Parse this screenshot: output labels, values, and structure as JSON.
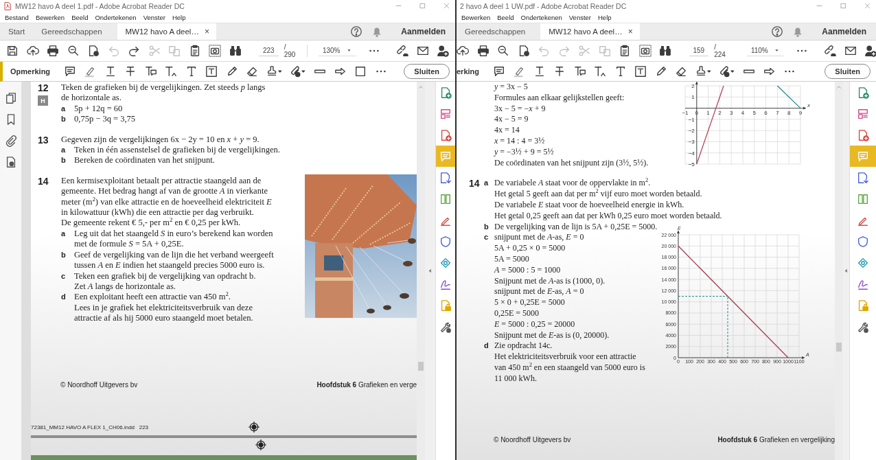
{
  "windows": [
    {
      "app_icon": true,
      "title": "MW12 havo A deel 1.pdf - Adobe Acrobat Reader DC",
      "menu": [
        "Bestand",
        "Bewerken",
        "Beeld",
        "Ondertekenen",
        "Venster",
        "Help"
      ],
      "tabs": [
        {
          "label": "Start",
          "selected": false
        },
        {
          "label": "Gereedschappen",
          "selected": false
        },
        {
          "label": "MW12 havo A deel…",
          "selected": true,
          "close": "×"
        }
      ],
      "sign_in": "Aanmelden",
      "toolbar": {
        "tools": [
          {
            "kind": "save",
            "disabled": false
          },
          {
            "kind": "upload",
            "disabled": false
          },
          {
            "kind": "print",
            "disabled": false
          },
          {
            "kind": "magnifier",
            "disabled": false
          },
          {
            "kind": "review",
            "disabled": false
          },
          {
            "kind": "undo",
            "disabled": true
          },
          {
            "kind": "redo",
            "disabled": false
          },
          {
            "kind": "cut",
            "disabled": true
          },
          {
            "kind": "copy",
            "disabled": true
          },
          {
            "kind": "clipboard",
            "disabled": false
          },
          {
            "kind": "snapshot",
            "disabled": false
          },
          {
            "kind": "find",
            "disabled": false
          }
        ],
        "page": {
          "current": "223",
          "total": "/ 290"
        },
        "zoom": "130%",
        "end_tools": [
          {
            "kind": "link"
          },
          {
            "kind": "mail"
          },
          {
            "kind": "adduser"
          }
        ]
      },
      "comment_bar": {
        "label": "Opmerking",
        "tools": [
          {
            "kind": "note"
          },
          {
            "kind": "highlight"
          },
          {
            "kind": "underline"
          },
          {
            "kind": "strike"
          },
          {
            "kind": "textnote"
          },
          {
            "kind": "insert"
          },
          {
            "kind": "text"
          },
          {
            "kind": "textbox"
          },
          {
            "kind": "pencil"
          },
          {
            "kind": "eraser"
          },
          {
            "kind": "stamp"
          },
          {
            "kind": "attach"
          },
          {
            "kind": "line"
          },
          {
            "kind": "arrow"
          },
          {
            "kind": "rect"
          }
        ],
        "close": "Sluiten"
      },
      "side_rail": [
        {
          "kind": "pages"
        },
        {
          "kind": "bookmark"
        },
        {
          "kind": "paperclip"
        },
        {
          "kind": "tagdoc"
        }
      ],
      "tool_panel": [
        {
          "kind": "create",
          "selected": false
        },
        {
          "kind": "layout",
          "selected": false
        },
        {
          "kind": "combine",
          "selected": false
        },
        {
          "kind": "comment",
          "selected": true
        },
        {
          "kind": "export",
          "selected": false
        },
        {
          "kind": "organize",
          "selected": false
        },
        {
          "kind": "edit",
          "selected": false
        },
        {
          "kind": "protect",
          "selected": false
        },
        {
          "kind": "certify",
          "selected": false
        },
        {
          "kind": "sign",
          "selected": false
        },
        {
          "kind": "lockdoc",
          "selected": false
        },
        {
          "kind": "tools",
          "selected": false
        }
      ],
      "page": {
        "blocks": [
          {
            "number": "12",
            "badge": "H",
            "lines": [
              "Teken de grafieken bij de vergelijkingen. Zet steeds *p* langs",
              "de horizontale as."
            ],
            "parts": [
              {
                "label": "a",
                "lines": [
                  "5p + 12q = 60"
                ]
              },
              {
                "label": "b",
                "lines": [
                  "0,75p − 3q = 3,75"
                ]
              }
            ]
          },
          {
            "number": "13",
            "lines": [
              "Gegeven zijn de vergelijkingen 6x − 2y = 10 en *x* + *y* = 9."
            ],
            "parts": [
              {
                "label": "a",
                "lines": [
                  "Teken in één assenstelsel de grafieken bij de vergelijkingen."
                ]
              },
              {
                "label": "b",
                "lines": [
                  "Bereken de coördinaten van het snijpunt."
                ]
              }
            ]
          },
          {
            "number": "14",
            "picture": {
              "kind": "picture"
            },
            "lines": [
              "Een kermisexploitant betaalt per attractie staangeld aan de",
              "gemeente. Het bedrag hangt af van de grootte *A* in vierkante",
              "meter (m$^{2}$) van elke attractie en de hoeveelheid elektriciteit *E*",
              "in kilowattuur (kWh) die een attractie per dag verbruikt.",
              "De gemeente rekent € 5,- per m$^{2}$ en € 0,25 per kWh."
            ],
            "parts": [
              {
                "label": "a",
                "lines": [
                  "Leg uit dat het staangeld *S* in euro’s berekend kan worden",
                  "met de formule *S* = 5A + 0,25E."
                ]
              },
              {
                "label": "b",
                "lines": [
                  "Geef de vergelijking van de lijn die het verband weergeeft",
                  "tussen *A* en *E* indien het staangeld precies 5000 euro is."
                ]
              },
              {
                "label": "c",
                "lines": [
                  "Teken een grafiek bij de vergelijking van opdracht b.",
                  "Zet *A* langs de horizontale as."
                ]
              },
              {
                "label": "d",
                "lines": [
                  "Een exploitant heeft een attractie van 450 m$^{2}$.",
                  "Lees in je grafiek het elektriciteitsverbruik van deze",
                  "attractie af als hij 5000 euro staangeld moet betalen."
                ]
              }
            ]
          }
        ],
        "footer": {
          "left": "© Noordhoff Uitgevers bv",
          "right": "**Hoofdstuk 6** Grafieken en verge"
        },
        "slug": "72381_MM12 HAVO A FLEX 1_CH06.indd   223"
      }
    },
    {
      "title": "2 havo A deel 1 UW.pdf - Adobe Acrobat Reader DC",
      "menu": [
        "Bewerken",
        "Beeld",
        "Ondertekenen",
        "Venster",
        "Help"
      ],
      "tabs": [
        {
          "label": "Gereedschappen",
          "selected": false
        },
        {
          "label": "MW12 havo A deel…",
          "selected": true,
          "close": "×"
        }
      ],
      "sign_in": "Aanmelden",
      "toolbar": {
        "tools": [
          {
            "kind": "upload",
            "disabled": false
          },
          {
            "kind": "print",
            "disabled": false
          },
          {
            "kind": "magnifier",
            "disabled": false
          },
          {
            "kind": "review",
            "disabled": false
          },
          {
            "kind": "undo",
            "disabled": true
          },
          {
            "kind": "redo",
            "disabled": true
          },
          {
            "kind": "cut",
            "disabled": true
          },
          {
            "kind": "copy",
            "disabled": true
          },
          {
            "kind": "clipboard",
            "disabled": false
          },
          {
            "kind": "snapshot",
            "disabled": false
          },
          {
            "kind": "find",
            "disabled": false
          }
        ],
        "page": {
          "current": "159",
          "total": "/ 224"
        },
        "zoom": "110%",
        "end_tools": [
          {
            "kind": "link"
          },
          {
            "kind": "mail"
          },
          {
            "kind": "adduser"
          }
        ]
      },
      "comment_bar": {
        "label": "erking",
        "tools": [
          {
            "kind": "note"
          },
          {
            "kind": "highlight"
          },
          {
            "kind": "underline"
          },
          {
            "kind": "strike"
          },
          {
            "kind": "textnote"
          },
          {
            "kind": "insert"
          },
          {
            "kind": "text"
          },
          {
            "kind": "textbox"
          },
          {
            "kind": "pencil"
          },
          {
            "kind": "eraser"
          },
          {
            "kind": "stamp"
          },
          {
            "kind": "attach"
          },
          {
            "kind": "line"
          },
          {
            "kind": "arrow"
          }
        ],
        "close": "Sluiten"
      },
      "tool_panel": [
        {
          "kind": "create",
          "selected": false
        },
        {
          "kind": "layout",
          "selected": false
        },
        {
          "kind": "combine",
          "selected": false
        },
        {
          "kind": "comment",
          "selected": true
        },
        {
          "kind": "export",
          "selected": false
        },
        {
          "kind": "organize",
          "selected": false
        },
        {
          "kind": "edit",
          "selected": false
        },
        {
          "kind": "protect",
          "selected": false
        },
        {
          "kind": "certify",
          "selected": false
        },
        {
          "kind": "sign",
          "selected": false
        },
        {
          "kind": "lockdoc",
          "selected": false
        },
        {
          "kind": "tools",
          "selected": false
        }
      ],
      "page": {
        "blocks": [
          {
            "parts": [
              {
                "lines": [
                  "*y* = 3x − 5",
                  "Formules aan elkaar gelijkstellen geeft:",
                  "3x − 5 = −*x* + 9",
                  "4x − 5 = 9",
                  "4x = 14",
                  "*x* = 14 : 4 = 3½",
                  "*y* = −3½ + 9 = 5½",
                  "De coördinaten van het snijpunt zijn (3½, 5½)."
                ]
              }
            ],
            "chart_data": {
              "type": "line",
              "grid": true,
              "xlabel": "x",
              "x": [
                0,
                2.333,
                7,
                9
              ],
              "series": [
                {
                  "color": "#b5475c",
                  "values": [
                    -5,
                    2,
                    null,
                    null
                  ]
                },
                {
                  "color": "#1f8f86",
                  "values": [
                    null,
                    null,
                    2,
                    0
                  ]
                }
              ],
              "xlim": [
                -1,
                9
              ],
              "ylim": [
                -5,
                2
              ],
              "xticks": [
                {
                  "value": -1,
                  "label": "−1"
                },
                0,
                1,
                2,
                3,
                4,
                5,
                6,
                7,
                8,
                9
              ],
              "yticks": [
                {
                  "value": -5,
                  "label": "−5"
                },
                {
                  "value": -4,
                  "label": "−4"
                },
                {
                  "value": -3,
                  "label": "−3"
                },
                {
                  "value": -2,
                  "label": "−2"
                },
                {
                  "value": -1,
                  "label": "−1"
                },
                1,
                2
              ]
            }
          },
          {
            "number": "14",
            "parts": [
              {
                "label": "a",
                "lines": [
                  "De variabele *A* staat voor de oppervlakte in m$^{2}$.",
                  "Het getal 5 geeft aan dat per m$^{2}$ vijf euro moet worden betaald.",
                  "De variabele *E* staat voor de hoeveelheid energie in kWh.",
                  "Het getal 0,25 geeft aan dat per kWh 0,25 euro moet worden betaald."
                ]
              },
              {
                "label": "b",
                "lines": [
                  "De vergelijking van de lijn is 5A + 0,25E = 5000."
                ]
              }
            ]
          },
          {
            "parts": [
              {
                "label": "c",
                "lines": [
                  "snijpunt met de *A*-as, *E* = 0",
                  "5A + 0,25 × 0 = 5000",
                  "5A = 5000",
                  "*A* = 5000 : 5 = 1000",
                  "Snijpunt met de *A*-as is (1000, 0).",
                  "snijpunt met de *E*-as, *A* = 0",
                  "5 × 0 + 0,25E = 5000",
                  "0,25E = 5000",
                  "*E* = 5000 : 0,25 = 20000",
                  "Snijpunt met de *E*-as is (0, 20000)."
                ]
              },
              {
                "label": "d",
                "lines": [
                  "Zie opdracht 14c.",
                  "Het elektriciteitsverbruik voor een attractie",
                  "van 450 m$^{2}$ en een staangeld van 5000 euro is",
                  "11 000 kWh."
                ]
              }
            ],
            "chart_data": {
              "type": "line",
              "grid": true,
              "xlabel": "A",
              "ylabel": "E",
              "x": [
                0,
                1000
              ],
              "series": [
                {
                  "color": "#a33a4f",
                  "values": [
                    20000,
                    0
                  ]
                }
              ],
              "xlim": [
                0,
                1100
              ],
              "ylim": [
                0,
                22000
              ],
              "xticks": [
                0,
                100,
                200,
                300,
                400,
                500,
                600,
                700,
                800,
                900,
                1000,
                1100
              ],
              "yticks": [
                0,
                2000,
                4000,
                6000,
                8000,
                {
                  "value": 10000,
                  "label": "10 000"
                },
                {
                  "value": 12000,
                  "label": "12 000"
                },
                {
                  "value": 14000,
                  "label": "14 000"
                },
                {
                  "value": 16000,
                  "label": "16 000"
                },
                {
                  "value": 18000,
                  "label": "18 000"
                },
                {
                  "value": 20000,
                  "label": "20 000"
                },
                {
                  "value": 22000,
                  "label": "22 000"
                }
              ],
              "ref_lines": [
                {
                  "axis": "x",
                  "value": 450,
                  "color": "#1f8f86"
                },
                {
                  "axis": "y",
                  "value": 11000,
                  "color": "#1f8f86"
                }
              ]
            }
          }
        ],
        "footer": {
          "left": "© Noordhoff Uitgevers bv",
          "right": "**Hoofdstuk 6** Grafieken en vergelijking"
        }
      }
    }
  ]
}
